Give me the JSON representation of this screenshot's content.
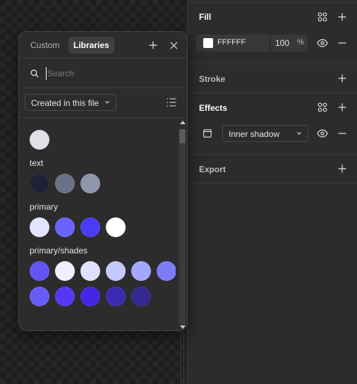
{
  "properties": {
    "fill": {
      "title": "Fill",
      "hex": "FFFFFF",
      "opacity": "100",
      "percent": "%",
      "swatch_color": "#FFFFFF",
      "icons": [
        "styles-grid-icon",
        "plus-icon",
        "eye-icon",
        "minus-icon"
      ]
    },
    "stroke": {
      "title": "Stroke",
      "icons": [
        "plus-icon"
      ]
    },
    "effects": {
      "title": "Effects",
      "effect_type": "Inner shadow",
      "icons": [
        "styles-grid-icon",
        "plus-icon",
        "effect-settings-icon",
        "chevron-down-icon",
        "eye-icon",
        "minus-icon"
      ]
    },
    "export": {
      "title": "Export",
      "icons": [
        "plus-icon"
      ]
    }
  },
  "popover": {
    "tabs": [
      {
        "label": "Custom",
        "active": false
      },
      {
        "label": "Libraries",
        "active": true
      }
    ],
    "header_icons": [
      "plus-icon",
      "close-icon"
    ],
    "search": {
      "placeholder": "Search",
      "value": ""
    },
    "filter": {
      "label": "Created in this file"
    },
    "view_toggle_icon": "list-view-icon",
    "groups": [
      {
        "label": "",
        "colors": [
          "#E0E0E6"
        ]
      },
      {
        "label": "text",
        "colors": [
          "#1E2033",
          "#6B7087",
          "#8E96A9"
        ]
      },
      {
        "label": "primary",
        "colors": [
          "#E3E3FF",
          "#6B63FF",
          "#4C3BF5",
          "#FFFFFF"
        ]
      },
      {
        "label": "primary/shades",
        "colors": [
          "#6355F5",
          "#EEEFFF",
          "#DFE1FF",
          "#C5C8FF",
          "#A3A7FF",
          "#7C7BF7",
          "#685CF9",
          "#5338F6",
          "#4427E3",
          "#3D2AB2",
          "#35288E"
        ]
      }
    ]
  }
}
